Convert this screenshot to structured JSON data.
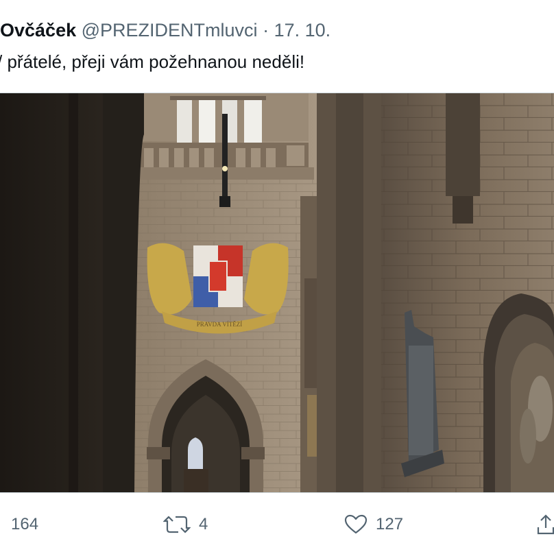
{
  "tweet": {
    "author_name": "Ovčáček",
    "handle": "@PREZIDENTmluvci",
    "separator": "·",
    "date": "17. 10.",
    "text": "přátelé, přeji vám požehnanou neděli!",
    "partial_text_prefix": "/"
  },
  "media": {
    "description_icon": "cathedral-photo",
    "emblem_motto": "PRAVDA VÍTĚZÍ"
  },
  "actions": {
    "reply_count": "164",
    "retweet_count": "4",
    "like_count": "127",
    "icons": {
      "retweet": "retweet-icon",
      "like": "heart-icon",
      "share": "share-icon"
    }
  }
}
